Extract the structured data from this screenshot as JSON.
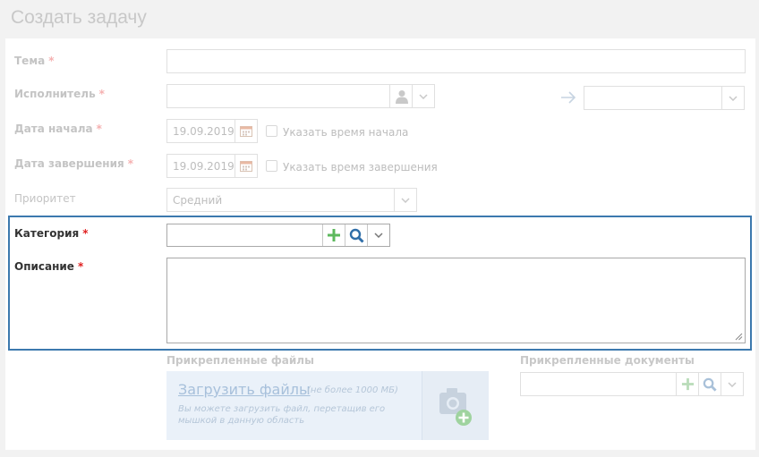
{
  "page_title": "Создать задачу",
  "form": {
    "subject": {
      "label": "Тема",
      "required": "*",
      "value": ""
    },
    "assignee": {
      "label": "Исполнитель",
      "required": "*",
      "value": ""
    },
    "start_date": {
      "label": "Дата начала",
      "required": "*",
      "value": "19.09.2019",
      "checkbox_label": "Указать время начала"
    },
    "end_date": {
      "label": "Дата завершения",
      "required": "*",
      "value": "19.09.2019",
      "checkbox_label": "Указать время завершения"
    },
    "priority": {
      "label": "Приоритет",
      "value": "Средний"
    },
    "category": {
      "label": "Категория",
      "required": "*",
      "value": ""
    },
    "description": {
      "label": "Описание",
      "required": "*",
      "value": ""
    }
  },
  "attachments": {
    "files_title": "Прикрепленные файлы",
    "upload_link": "Загрузить файлы",
    "upload_limit": "(не более 1000 МБ)",
    "upload_hint": "Вы можете загрузить файл, перетащив его мышкой в данную область",
    "documents_title": "Прикрепленные документы"
  },
  "colors": {
    "highlight": "#3c79ae",
    "required_active": "#e02020",
    "add_green": "#5cb85c",
    "search_blue": "#2f6ea8"
  },
  "icons": [
    "user-icon",
    "chevron-down-icon",
    "arrow-right-icon",
    "calendar-icon",
    "plus-icon",
    "search-icon",
    "camera-add-icon",
    "resize-grip-icon"
  ]
}
